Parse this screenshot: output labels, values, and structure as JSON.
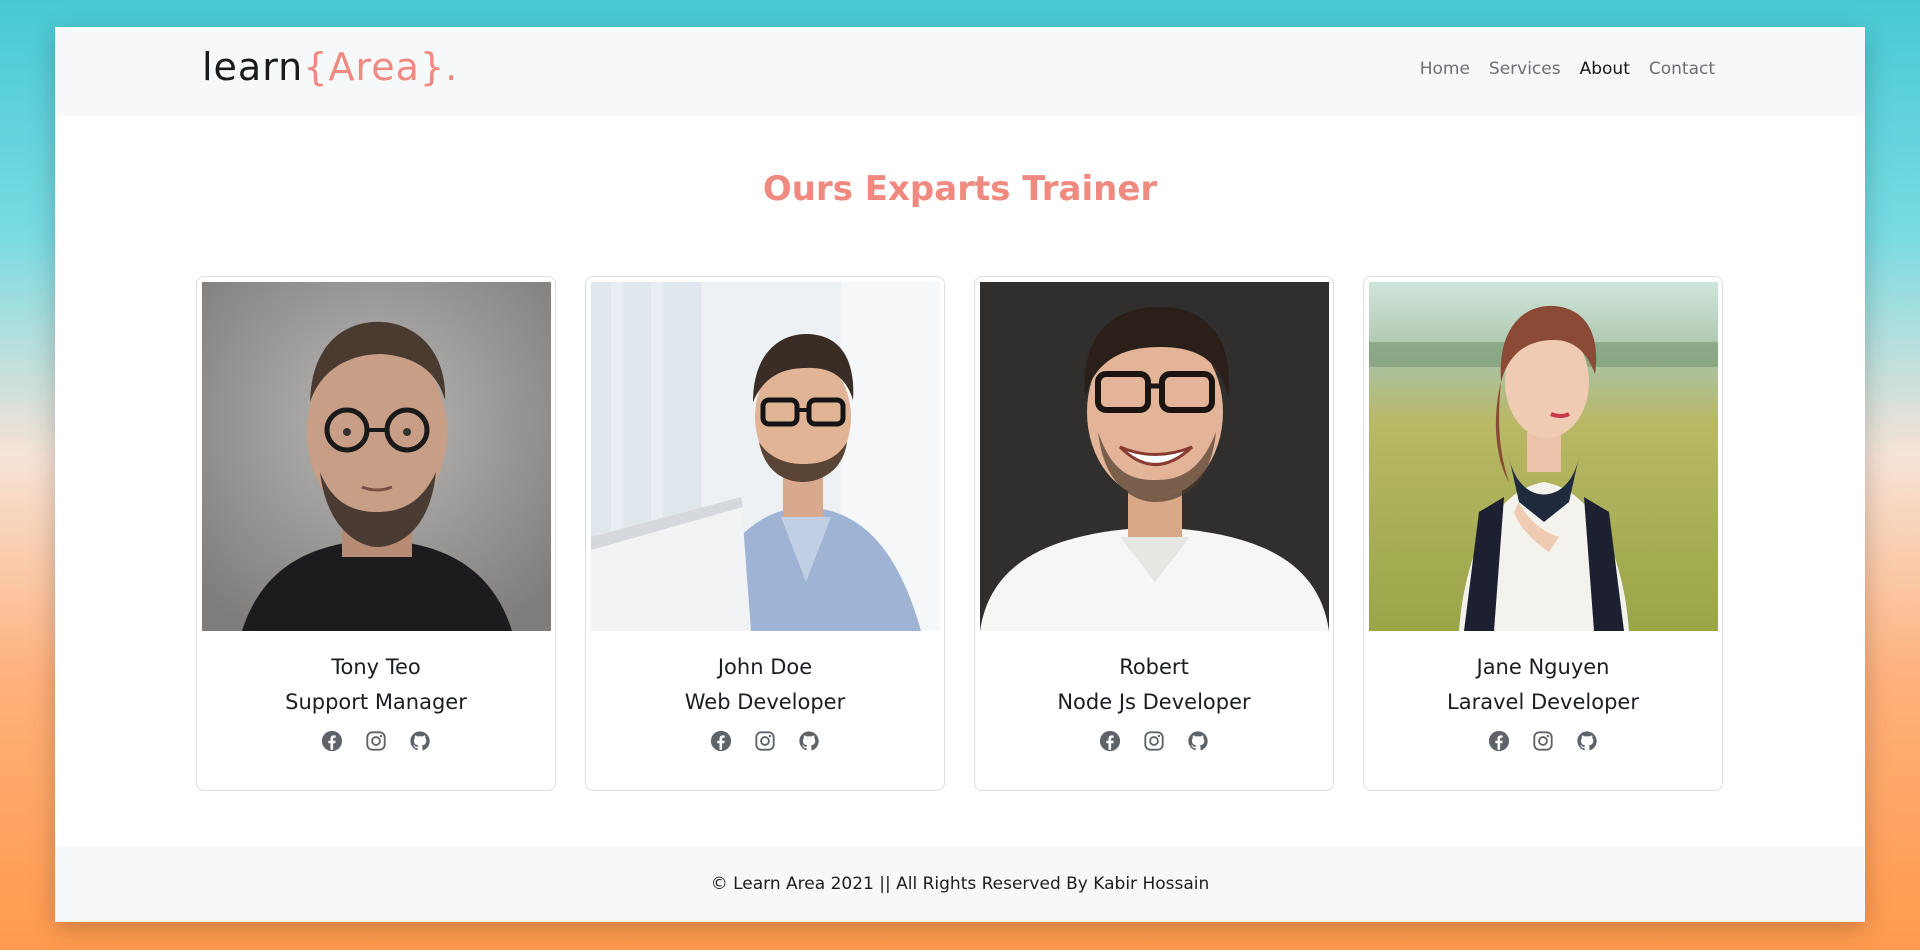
{
  "header": {
    "logo_main": "learn",
    "logo_accent": "{Area}.",
    "nav": [
      {
        "label": "Home",
        "active": false
      },
      {
        "label": "Services",
        "active": false
      },
      {
        "label": "About",
        "active": true
      },
      {
        "label": "Contact",
        "active": false
      }
    ]
  },
  "section": {
    "title": "Ours Exparts Trainer"
  },
  "trainers": [
    {
      "name": "Tony Teo",
      "role": "Support Manager",
      "socials": [
        "facebook-icon",
        "instagram-icon",
        "github-icon"
      ]
    },
    {
      "name": "John Doe",
      "role": "Web Developer",
      "socials": [
        "facebook-icon",
        "instagram-icon",
        "github-icon"
      ]
    },
    {
      "name": "Robert",
      "role": "Node Js Developer",
      "socials": [
        "facebook-icon",
        "instagram-icon",
        "github-icon"
      ]
    },
    {
      "name": "Jane Nguyen",
      "role": "Laravel Developer",
      "socials": [
        "facebook-icon",
        "instagram-icon",
        "github-icon"
      ]
    }
  ],
  "footer": {
    "text": "© Learn Area 2021 || All Rights Reserved By Kabir Hossain"
  },
  "colors": {
    "accent": "#f08a80",
    "text": "#1b1d21",
    "nav_muted": "#6c6f74",
    "icon": "#5f6368"
  }
}
